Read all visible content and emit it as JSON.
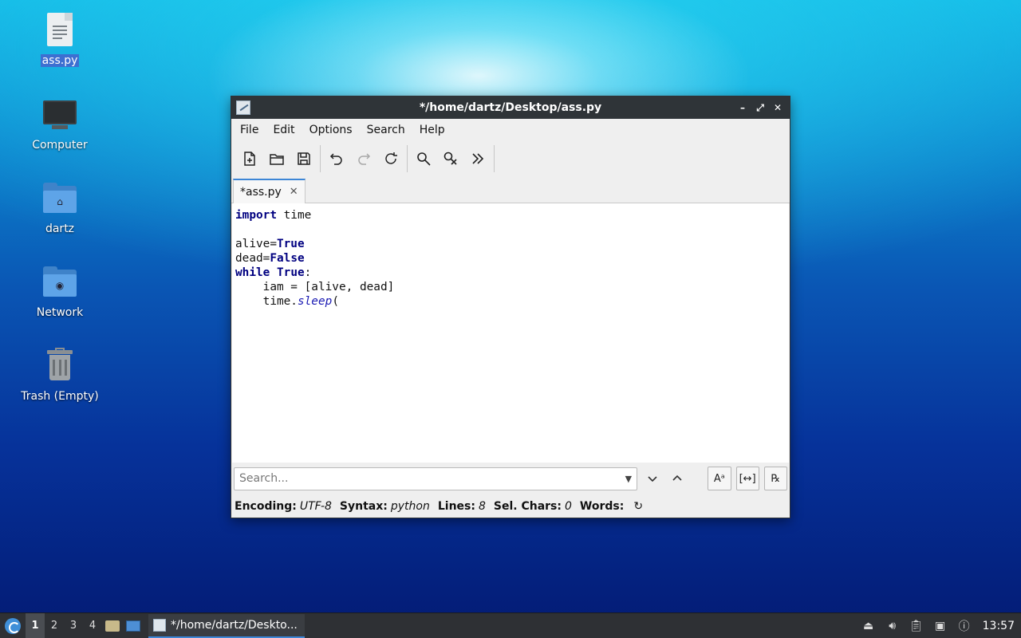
{
  "desktop": {
    "icons": [
      {
        "label": "ass.py"
      },
      {
        "label": "Computer"
      },
      {
        "label": "dartz"
      },
      {
        "label": "Network"
      },
      {
        "label": "Trash (Empty)"
      }
    ]
  },
  "window": {
    "title": "*/home/dartz/Desktop/ass.py",
    "controls": {
      "minimize": "–",
      "maximize": "⤢",
      "close": "✕"
    },
    "menu": [
      "File",
      "Edit",
      "Options",
      "Search",
      "Help"
    ],
    "toolbar": {
      "icons": [
        "new-file-icon",
        "open-folder-icon",
        "save-icon",
        "undo-icon",
        "redo-icon",
        "reload-icon",
        "find-icon",
        "find-replace-icon",
        "more-icon"
      ]
    },
    "tab": {
      "label": "*ass.py",
      "close": "✕"
    },
    "editor": {
      "lines": [
        [
          {
            "t": "import",
            "c": "kw"
          },
          {
            "t": " time",
            "c": ""
          }
        ],
        [
          {
            "t": "",
            "c": ""
          }
        ],
        [
          {
            "t": "alive=",
            "c": ""
          },
          {
            "t": "True",
            "c": "kw"
          }
        ],
        [
          {
            "t": "dead=",
            "c": ""
          },
          {
            "t": "False",
            "c": "kw"
          }
        ],
        [
          {
            "t": "while",
            "c": "kw"
          },
          {
            "t": " ",
            "c": ""
          },
          {
            "t": "True",
            "c": "kw"
          },
          {
            "t": ":",
            "c": ""
          }
        ],
        [
          {
            "t": "    iam = [alive, dead]",
            "c": ""
          }
        ],
        [
          {
            "t": "    time.",
            "c": ""
          },
          {
            "t": "sleep",
            "c": "fn"
          },
          {
            "t": "(",
            "c": ""
          }
        ]
      ]
    },
    "search": {
      "placeholder": "Search...",
      "value": "",
      "match_case_label": "Aᵃ",
      "whole_word_label": "[↔]",
      "regex_label": "℞"
    },
    "status": {
      "encoding_label": "Encoding:",
      "encoding": "UTF-8",
      "syntax_label": "Syntax:",
      "syntax": "python",
      "lines_label": "Lines:",
      "lines": "8",
      "sel_label": "Sel. Chars:",
      "sel": "0",
      "words_label": "Words:",
      "words_refresh": "↻"
    }
  },
  "taskbar": {
    "workspaces": [
      "1",
      "2",
      "3",
      "4"
    ],
    "active_workspace": "1",
    "task_label": "*/home/dartz/Deskto...",
    "clock": "13:57"
  }
}
